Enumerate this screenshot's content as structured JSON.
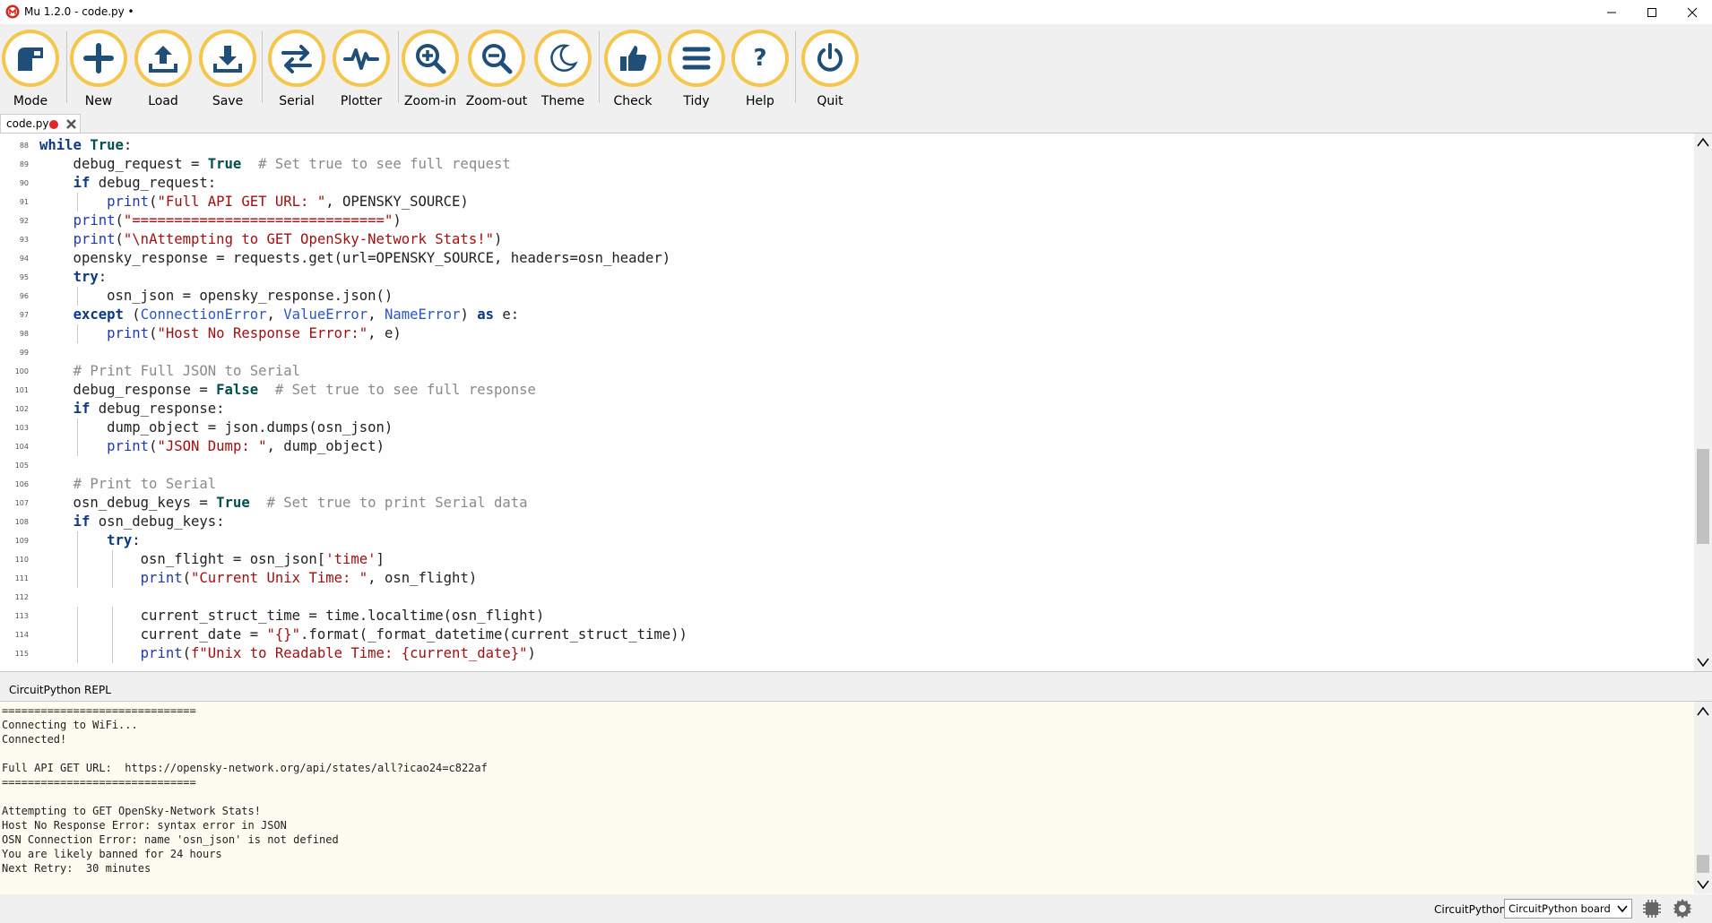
{
  "window": {
    "title": "Mu 1.2.0 - code.py •"
  },
  "toolbar": {
    "buttons": [
      {
        "label": "Mode",
        "icon": "mode-icon"
      },
      {
        "label": "New",
        "icon": "plus-icon"
      },
      {
        "label": "Load",
        "icon": "upload-icon"
      },
      {
        "label": "Save",
        "icon": "download-icon"
      },
      {
        "label": "Serial",
        "icon": "swap-arrows-icon"
      },
      {
        "label": "Plotter",
        "icon": "pulse-icon"
      },
      {
        "label": "Zoom-in",
        "icon": "zoom-in-icon"
      },
      {
        "label": "Zoom-out",
        "icon": "zoom-out-icon"
      },
      {
        "label": "Theme",
        "icon": "moon-icon"
      },
      {
        "label": "Check",
        "icon": "thumbs-up-icon"
      },
      {
        "label": "Tidy",
        "icon": "lines-icon"
      },
      {
        "label": "Help",
        "icon": "question-icon"
      },
      {
        "label": "Quit",
        "icon": "power-icon"
      }
    ],
    "accent_color": "#f5c64b"
  },
  "tab": {
    "label": "code.py",
    "unsaved_color": "#e0242b"
  },
  "editor": {
    "lines": [
      {
        "n": "88",
        "text": "while True:"
      },
      {
        "n": "89",
        "text": "    debug_request = True  # Set true to see full request"
      },
      {
        "n": "90",
        "text": "    if debug_request:"
      },
      {
        "n": "91",
        "text": "        print(\"Full API GET URL: \", OPENSKY_SOURCE)"
      },
      {
        "n": "92",
        "text": "    print(\"==============================\")"
      },
      {
        "n": "93",
        "text": "    print(\"\\nAttempting to GET OpenSky-Network Stats!\")"
      },
      {
        "n": "94",
        "text": "    opensky_response = requests.get(url=OPENSKY_SOURCE, headers=osn_header)"
      },
      {
        "n": "95",
        "text": "    try:"
      },
      {
        "n": "96",
        "text": "        osn_json = opensky_response.json()"
      },
      {
        "n": "97",
        "text": "    except (ConnectionError, ValueError, NameError) as e:"
      },
      {
        "n": "98",
        "text": "        print(\"Host No Response Error:\", e)"
      },
      {
        "n": "99",
        "text": ""
      },
      {
        "n": "100",
        "text": "    # Print Full JSON to Serial"
      },
      {
        "n": "101",
        "text": "    debug_response = False  # Set true to see full response"
      },
      {
        "n": "102",
        "text": "    if debug_response:"
      },
      {
        "n": "103",
        "text": "        dump_object = json.dumps(osn_json)"
      },
      {
        "n": "104",
        "text": "        print(\"JSON Dump: \", dump_object)"
      },
      {
        "n": "105",
        "text": ""
      },
      {
        "n": "106",
        "text": "    # Print to Serial"
      },
      {
        "n": "107",
        "text": "    osn_debug_keys = True  # Set true to print Serial data"
      },
      {
        "n": "108",
        "text": "    if osn_debug_keys:"
      },
      {
        "n": "109",
        "text": "        try:"
      },
      {
        "n": "110",
        "text": "            osn_flight = osn_json['time']"
      },
      {
        "n": "111",
        "text": "            print(\"Current Unix Time: \", osn_flight)"
      },
      {
        "n": "112",
        "text": ""
      },
      {
        "n": "113",
        "text": "            current_struct_time = time.localtime(osn_flight)"
      },
      {
        "n": "114",
        "text": "            current_date = \"{}\".format(_format_datetime(current_struct_time))"
      },
      {
        "n": "115",
        "text": "            print(f\"Unix to Readable Time: {current_date}\")"
      }
    ]
  },
  "repl": {
    "title": "CircuitPython REPL",
    "lines": [
      "==============================",
      "Connecting to WiFi...",
      "Connected!",
      "",
      "Full API GET URL:  https://opensky-network.org/api/states/all?icao24=c822af",
      "==============================",
      "",
      "Attempting to GET OpenSky-Network Stats!",
      "Host No Response Error: syntax error in JSON",
      "OSN Connection Error: name 'osn_json' is not defined",
      "You are likely banned for 24 hours",
      "Next Retry:  30 minutes"
    ]
  },
  "statusbar": {
    "mode": "CircuitPython",
    "board": "CircuitPython board"
  }
}
